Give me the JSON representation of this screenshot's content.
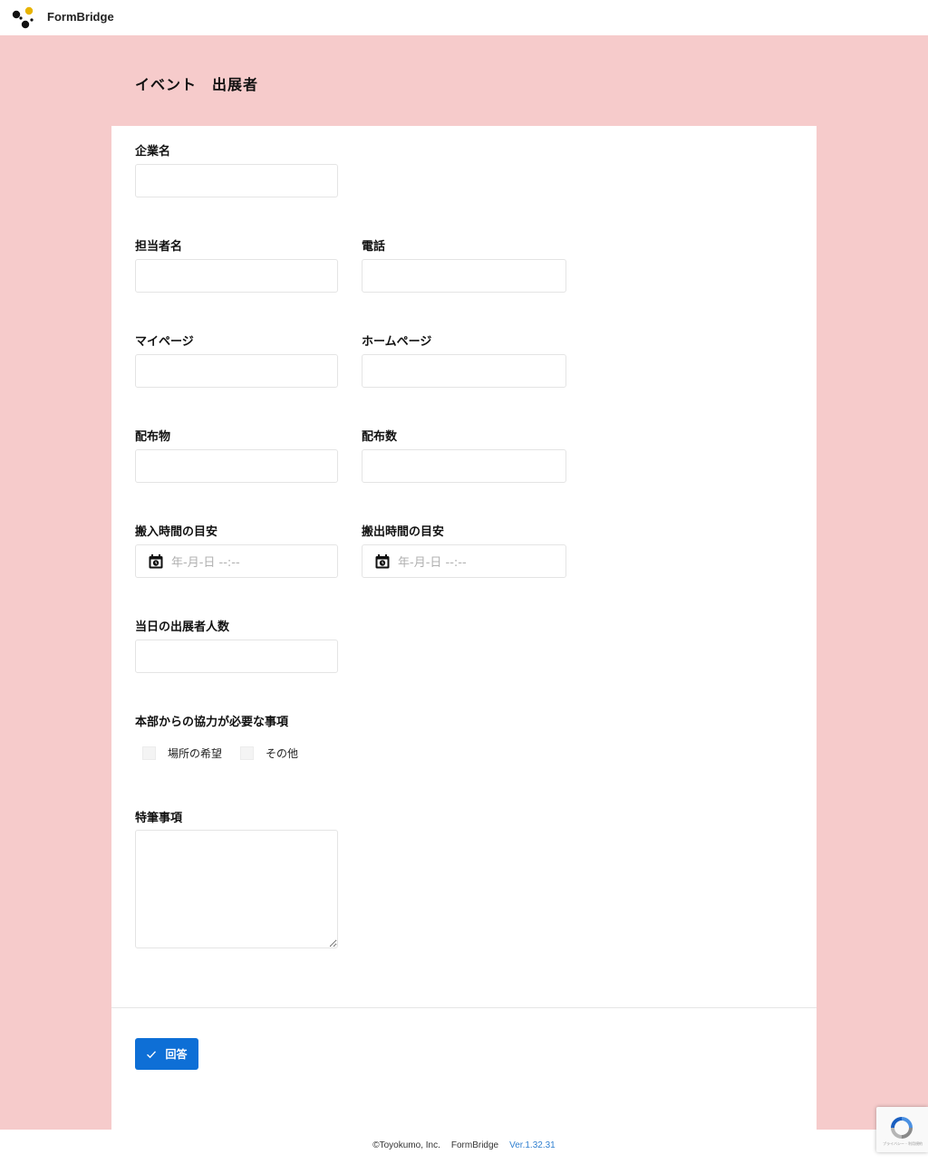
{
  "header": {
    "brand_name": "FormBridge"
  },
  "form": {
    "title": "イベント　出展者",
    "fields": {
      "company_name": {
        "label": "企業名"
      },
      "contact_name": {
        "label": "担当者名"
      },
      "phone": {
        "label": "電話"
      },
      "mypage": {
        "label": "マイページ"
      },
      "homepage": {
        "label": "ホームページ"
      },
      "distribution_items": {
        "label": "配布物"
      },
      "distribution_count": {
        "label": "配布数"
      },
      "load_in_time": {
        "label": "搬入時間の目安",
        "placeholder": "年-月-日 --:--"
      },
      "load_out_time": {
        "label": "搬出時間の目安",
        "placeholder": "年-月-日 --:--"
      },
      "exhibitor_count": {
        "label": "当日の出展者人数"
      },
      "support_needed": {
        "label": "本部からの協力が必要な事項",
        "options": [
          "場所の希望",
          "その他"
        ]
      },
      "remarks": {
        "label": "特筆事項"
      }
    },
    "submit_label": "回答"
  },
  "footer": {
    "copyright": "©Toyokumo, Inc.",
    "product": "FormBridge",
    "version": "Ver.1.32.31"
  },
  "recaptcha": {
    "text": "プライバシー - 利用規約"
  },
  "colors": {
    "background": "#f6cbcb",
    "accent": "#0e6fd6",
    "logo_accent": "#e8b400"
  },
  "icons": {
    "logo": "formbridge-logo-icon",
    "calendar": "calendar-icon",
    "check": "check-icon",
    "recaptcha": "recaptcha-icon"
  }
}
